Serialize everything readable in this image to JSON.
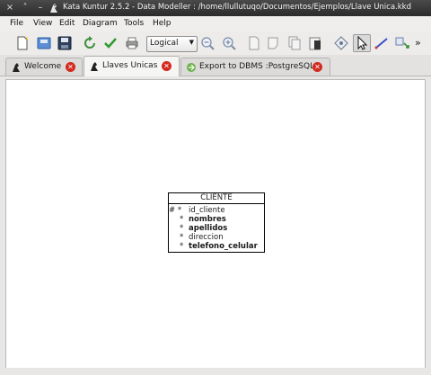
{
  "window": {
    "title": "Kata Kuntur 2.5.2 - Data Modeller : /home/llullutuqo/Documentos/Ejemplos/Llave Unica.kkd",
    "controls": [
      "×",
      "˄",
      "–"
    ]
  },
  "menu": [
    "File",
    "View",
    "Edit",
    "Diagram",
    "Tools",
    "Help"
  ],
  "toolbar": {
    "notation_select": "Logical",
    "overflow_label": "»",
    "icons": [
      "new-file-icon",
      "open-file-icon",
      "save-icon",
      "refresh-icon",
      "validate-check-icon",
      "print-icon",
      "zoom-out-icon",
      "zoom-in-icon",
      "new-note-icon",
      "cut-icon",
      "copy-icon",
      "paste-icon",
      "entity-tool-icon",
      "pointer-select-icon",
      "relation-line-icon",
      "generate-icon"
    ]
  },
  "tabs": [
    {
      "label": "Welcome",
      "selected": false
    },
    {
      "label": "Llaves Unicas",
      "selected": true
    },
    {
      "label": "Export to DBMS :PostgreSQL",
      "selected": false
    }
  ],
  "entity": {
    "name": "CLIENTE",
    "attributes": [
      {
        "marker": "# *",
        "name": "id_cliente",
        "bold": false
      },
      {
        "marker": "*",
        "name": "nombres",
        "bold": true
      },
      {
        "marker": "*",
        "name": "apellidos",
        "bold": true
      },
      {
        "marker": "*",
        "name": "direccion",
        "bold": false
      },
      {
        "marker": "*",
        "name": "telefono_celular",
        "bold": true
      }
    ]
  },
  "colors": {
    "close_badge": "#d22a1e",
    "titlebar": "#2b2b2b"
  }
}
